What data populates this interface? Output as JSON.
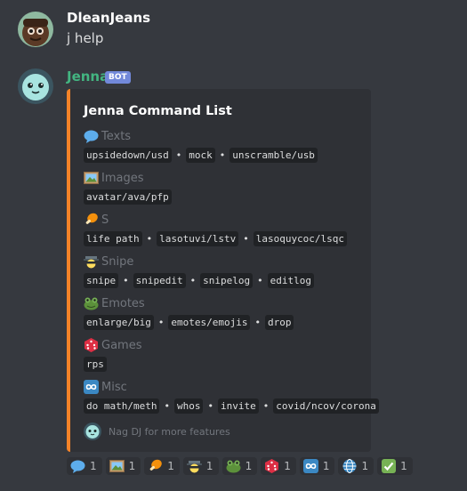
{
  "messages": [
    {
      "author": "DleanJeans",
      "author_color": "#ffffff",
      "content": "j help"
    },
    {
      "author": "Jenna",
      "author_color": "#43b581",
      "tag": "BOT"
    }
  ],
  "embed": {
    "accent_color": "#f48328",
    "title": "Jenna Command List",
    "fields": [
      {
        "icon": "speech-bubble-icon",
        "name": "Texts",
        "values": [
          "upsidedown/usd",
          "mock",
          "unscramble/usb"
        ]
      },
      {
        "icon": "framed-picture-icon",
        "name": "Images",
        "values": [
          "avatar/ava/pfp"
        ]
      },
      {
        "icon": "meat-icon",
        "name": "S",
        "values": [
          "life path",
          "lasotuvi/lstv",
          "lasoquycoc/lsqc"
        ]
      },
      {
        "icon": "spy-icon",
        "name": "Snipe",
        "values": [
          "snipe",
          "snipedit",
          "snipelog",
          "editlog"
        ]
      },
      {
        "icon": "frog-icon",
        "name": "Emotes",
        "values": [
          "enlarge/big",
          "emotes/emojis",
          "drop"
        ]
      },
      {
        "icon": "game-die-icon",
        "name": "Games",
        "values": [
          "rps"
        ]
      },
      {
        "icon": "infinity-icon",
        "name": "Misc",
        "values": [
          "do math/meth",
          "whos",
          "invite",
          "covid/ncov/corona"
        ]
      }
    ],
    "footer": "Nag DJ for more features"
  },
  "reactions": [
    {
      "icon": "speech-bubble-icon",
      "count": "1"
    },
    {
      "icon": "framed-picture-icon",
      "count": "1"
    },
    {
      "icon": "meat-icon",
      "count": "1"
    },
    {
      "icon": "spy-icon",
      "count": "1"
    },
    {
      "icon": "frog-icon",
      "count": "1"
    },
    {
      "icon": "game-die-icon",
      "count": "1"
    },
    {
      "icon": "infinity-icon",
      "count": "1"
    },
    {
      "icon": "globe-icon",
      "count": "1"
    },
    {
      "icon": "check-mark-icon",
      "count": "1"
    }
  ]
}
